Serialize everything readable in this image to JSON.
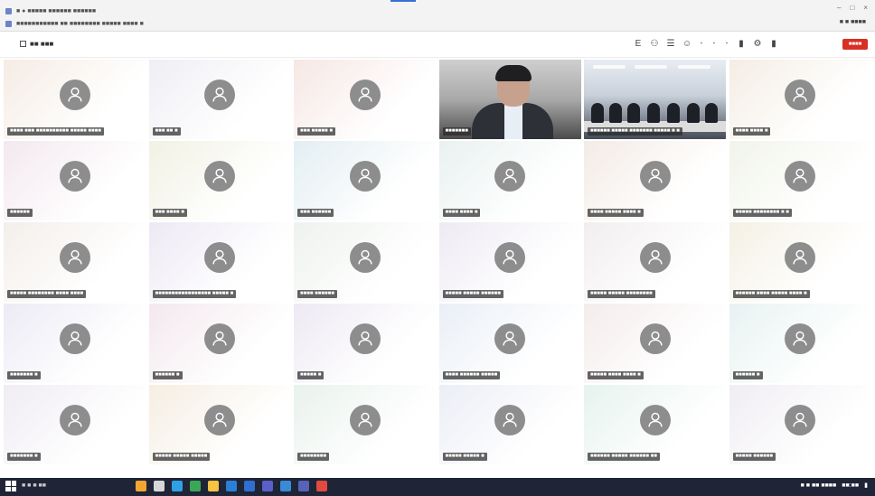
{
  "browser": {
    "tab_title": "■ ● ■■■■■ ■■■■■■ ■■■■■■",
    "url": "■■■■■■■■■■■ ■■ ■■■■■■■■ ■■■■■ ■■■■ ■",
    "account": "■ ■ ■■■■",
    "window_controls": [
      "–",
      "□",
      "×"
    ]
  },
  "meeting": {
    "left_label": "■■ ■■■",
    "leave_label": "■■■■",
    "tool_icons": [
      "e-icon",
      "participants-icon",
      "chat-icon",
      "reactions-icon",
      "more-icon",
      "camera-icon",
      "mic-icon",
      "share-icon"
    ]
  },
  "tiles": [
    {
      "name": "■■■■ ■■■ ■■■■■■■■■■ ■■■■■ ■■■■",
      "bg": "#f5ece4",
      "type": "avatar"
    },
    {
      "name": "■■■ ■■ ■",
      "bg": "#efeef4",
      "type": "avatar"
    },
    {
      "name": "■■■ ■■■■■ ■",
      "bg": "#f6e7e4",
      "type": "avatar"
    },
    {
      "name": "■■■■■■■",
      "bg": "#777777",
      "type": "video1"
    },
    {
      "name": "■■■■■■ ■■■■■ ■■■■■■■ ■■■■■ ■ ■",
      "bg": "#666666",
      "type": "video2"
    },
    {
      "name": "■■■■ ■■■■ ■",
      "bg": "#f4ede4",
      "type": "avatar"
    },
    {
      "name": "■■■■■■",
      "bg": "#f3e8ef",
      "type": "avatar"
    },
    {
      "name": "■■■ ■■■■ ■",
      "bg": "#f1f1e4",
      "type": "avatar"
    },
    {
      "name": "■■■ ■■■■■■",
      "bg": "#e3eef2",
      "type": "avatar"
    },
    {
      "name": "■■■■ ■■■■ ■",
      "bg": "#e9f1f0",
      "type": "avatar"
    },
    {
      "name": "■■■■ ■■■■■ ■■■■ ■",
      "bg": "#f3ebe5",
      "type": "avatar"
    },
    {
      "name": "■■■■■ ■■■■■■■■ ■ ■",
      "bg": "#f1f4ea",
      "type": "avatar"
    },
    {
      "name": "■■■■■ ■■■■■■■■ ■■■■ ■■■■",
      "bg": "#f3eeea",
      "type": "avatar"
    },
    {
      "name": "■■■■■■■■■■■■■■■■■ ■■■■■ ■",
      "bg": "#ede9f4",
      "type": "avatar"
    },
    {
      "name": "■■■■ ■■■■■■",
      "bg": "#eef2ee",
      "type": "avatar"
    },
    {
      "name": "■■■■■ ■■■■■ ■■■■■■",
      "bg": "#eeeaf3",
      "type": "avatar"
    },
    {
      "name": "■■■■■ ■■■■■ ■■■■■■■■",
      "bg": "#f2eef0",
      "type": "avatar"
    },
    {
      "name": "■■■■■■ ■■■■ ■■■■■ ■■■■ ■",
      "bg": "#f4f0e4",
      "type": "avatar"
    },
    {
      "name": "■■■■■■■ ■",
      "bg": "#ecebf5",
      "type": "avatar"
    },
    {
      "name": "■■■■■■ ■",
      "bg": "#f3e8ee",
      "type": "avatar"
    },
    {
      "name": "■■■■■ ■",
      "bg": "#eee9f3",
      "type": "avatar"
    },
    {
      "name": "■■■■ ■■■■■■ ■■■■■",
      "bg": "#eaeff6",
      "type": "avatar"
    },
    {
      "name": "■■■■■ ■■■■ ■■■■ ■",
      "bg": "#f4ecec",
      "type": "avatar"
    },
    {
      "name": "■■■■■■ ■",
      "bg": "#e8f2f2",
      "type": "avatar"
    },
    {
      "name": "■■■■■■■ ■",
      "bg": "#f0ecf3",
      "type": "avatar"
    },
    {
      "name": "■■■■■ ■■■■■ ■■■■■",
      "bg": "#f5eee2",
      "type": "avatar"
    },
    {
      "name": "■■■■■■■■",
      "bg": "#e9f2ed",
      "type": "avatar"
    },
    {
      "name": "■■■■■ ■■■■■ ■",
      "bg": "#eceef6",
      "type": "avatar"
    },
    {
      "name": "■■■■■■ ■■■■■ ■■■■■■ ■■",
      "bg": "#e6f3ef",
      "type": "avatar"
    },
    {
      "name": "■■■■■ ■■■■■■",
      "bg": "#f0edf3",
      "type": "avatar"
    }
  ],
  "taskbar": {
    "search_text": "■ ■ ■ ■■",
    "apps": [
      {
        "icon": "weather-icon",
        "color": "#f3a533"
      },
      {
        "icon": "task-view-icon",
        "color": "#d7d7d7"
      },
      {
        "icon": "edge-icon",
        "color": "#2fa0e8"
      },
      {
        "icon": "chrome-icon",
        "color": "#3aa757"
      },
      {
        "icon": "explorer-icon",
        "color": "#f6c342"
      },
      {
        "icon": "store-icon",
        "color": "#2b7fd6"
      },
      {
        "icon": "mail-icon",
        "color": "#2f6fd0"
      },
      {
        "icon": "teams-icon",
        "color": "#5b5fc7"
      },
      {
        "icon": "app-icon-1",
        "color": "#3a8bd6"
      },
      {
        "icon": "app-icon-2",
        "color": "#5663b6"
      },
      {
        "icon": "app-icon-3",
        "color": "#e04a3f"
      }
    ],
    "tray_text": "■ ■ ■■ ■■■■",
    "clock": "■■:■■"
  }
}
